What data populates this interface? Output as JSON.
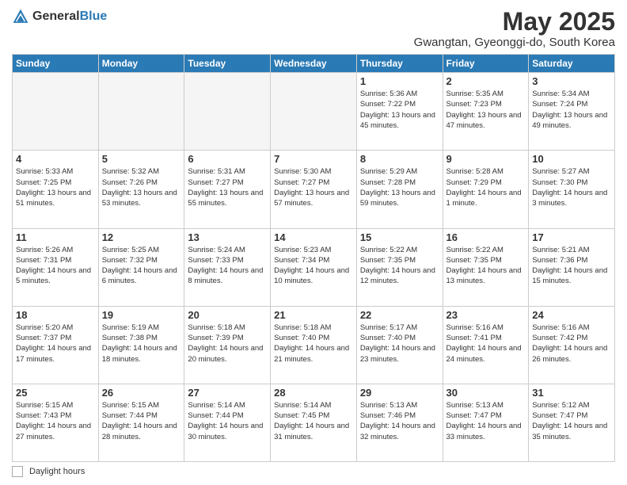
{
  "header": {
    "logo_general": "General",
    "logo_blue": "Blue",
    "month": "May 2025",
    "location": "Gwangtan, Gyeonggi-do, South Korea"
  },
  "days_of_week": [
    "Sunday",
    "Monday",
    "Tuesday",
    "Wednesday",
    "Thursday",
    "Friday",
    "Saturday"
  ],
  "weeks": [
    [
      {
        "day": "",
        "empty": true
      },
      {
        "day": "",
        "empty": true
      },
      {
        "day": "",
        "empty": true
      },
      {
        "day": "",
        "empty": true
      },
      {
        "day": "1",
        "sunrise": "5:36 AM",
        "sunset": "7:22 PM",
        "daylight": "13 hours and 45 minutes."
      },
      {
        "day": "2",
        "sunrise": "5:35 AM",
        "sunset": "7:23 PM",
        "daylight": "13 hours and 47 minutes."
      },
      {
        "day": "3",
        "sunrise": "5:34 AM",
        "sunset": "7:24 PM",
        "daylight": "13 hours and 49 minutes."
      }
    ],
    [
      {
        "day": "4",
        "sunrise": "5:33 AM",
        "sunset": "7:25 PM",
        "daylight": "13 hours and 51 minutes."
      },
      {
        "day": "5",
        "sunrise": "5:32 AM",
        "sunset": "7:26 PM",
        "daylight": "13 hours and 53 minutes."
      },
      {
        "day": "6",
        "sunrise": "5:31 AM",
        "sunset": "7:27 PM",
        "daylight": "13 hours and 55 minutes."
      },
      {
        "day": "7",
        "sunrise": "5:30 AM",
        "sunset": "7:27 PM",
        "daylight": "13 hours and 57 minutes."
      },
      {
        "day": "8",
        "sunrise": "5:29 AM",
        "sunset": "7:28 PM",
        "daylight": "13 hours and 59 minutes."
      },
      {
        "day": "9",
        "sunrise": "5:28 AM",
        "sunset": "7:29 PM",
        "daylight": "14 hours and 1 minute."
      },
      {
        "day": "10",
        "sunrise": "5:27 AM",
        "sunset": "7:30 PM",
        "daylight": "14 hours and 3 minutes."
      }
    ],
    [
      {
        "day": "11",
        "sunrise": "5:26 AM",
        "sunset": "7:31 PM",
        "daylight": "14 hours and 5 minutes."
      },
      {
        "day": "12",
        "sunrise": "5:25 AM",
        "sunset": "7:32 PM",
        "daylight": "14 hours and 6 minutes."
      },
      {
        "day": "13",
        "sunrise": "5:24 AM",
        "sunset": "7:33 PM",
        "daylight": "14 hours and 8 minutes."
      },
      {
        "day": "14",
        "sunrise": "5:23 AM",
        "sunset": "7:34 PM",
        "daylight": "14 hours and 10 minutes."
      },
      {
        "day": "15",
        "sunrise": "5:22 AM",
        "sunset": "7:35 PM",
        "daylight": "14 hours and 12 minutes."
      },
      {
        "day": "16",
        "sunrise": "5:22 AM",
        "sunset": "7:35 PM",
        "daylight": "14 hours and 13 minutes."
      },
      {
        "day": "17",
        "sunrise": "5:21 AM",
        "sunset": "7:36 PM",
        "daylight": "14 hours and 15 minutes."
      }
    ],
    [
      {
        "day": "18",
        "sunrise": "5:20 AM",
        "sunset": "7:37 PM",
        "daylight": "14 hours and 17 minutes."
      },
      {
        "day": "19",
        "sunrise": "5:19 AM",
        "sunset": "7:38 PM",
        "daylight": "14 hours and 18 minutes."
      },
      {
        "day": "20",
        "sunrise": "5:18 AM",
        "sunset": "7:39 PM",
        "daylight": "14 hours and 20 minutes."
      },
      {
        "day": "21",
        "sunrise": "5:18 AM",
        "sunset": "7:40 PM",
        "daylight": "14 hours and 21 minutes."
      },
      {
        "day": "22",
        "sunrise": "5:17 AM",
        "sunset": "7:40 PM",
        "daylight": "14 hours and 23 minutes."
      },
      {
        "day": "23",
        "sunrise": "5:16 AM",
        "sunset": "7:41 PM",
        "daylight": "14 hours and 24 minutes."
      },
      {
        "day": "24",
        "sunrise": "5:16 AM",
        "sunset": "7:42 PM",
        "daylight": "14 hours and 26 minutes."
      }
    ],
    [
      {
        "day": "25",
        "sunrise": "5:15 AM",
        "sunset": "7:43 PM",
        "daylight": "14 hours and 27 minutes."
      },
      {
        "day": "26",
        "sunrise": "5:15 AM",
        "sunset": "7:44 PM",
        "daylight": "14 hours and 28 minutes."
      },
      {
        "day": "27",
        "sunrise": "5:14 AM",
        "sunset": "7:44 PM",
        "daylight": "14 hours and 30 minutes."
      },
      {
        "day": "28",
        "sunrise": "5:14 AM",
        "sunset": "7:45 PM",
        "daylight": "14 hours and 31 minutes."
      },
      {
        "day": "29",
        "sunrise": "5:13 AM",
        "sunset": "7:46 PM",
        "daylight": "14 hours and 32 minutes."
      },
      {
        "day": "30",
        "sunrise": "5:13 AM",
        "sunset": "7:47 PM",
        "daylight": "14 hours and 33 minutes."
      },
      {
        "day": "31",
        "sunrise": "5:12 AM",
        "sunset": "7:47 PM",
        "daylight": "14 hours and 35 minutes."
      }
    ]
  ],
  "footer": {
    "daylight_label": "Daylight hours"
  }
}
